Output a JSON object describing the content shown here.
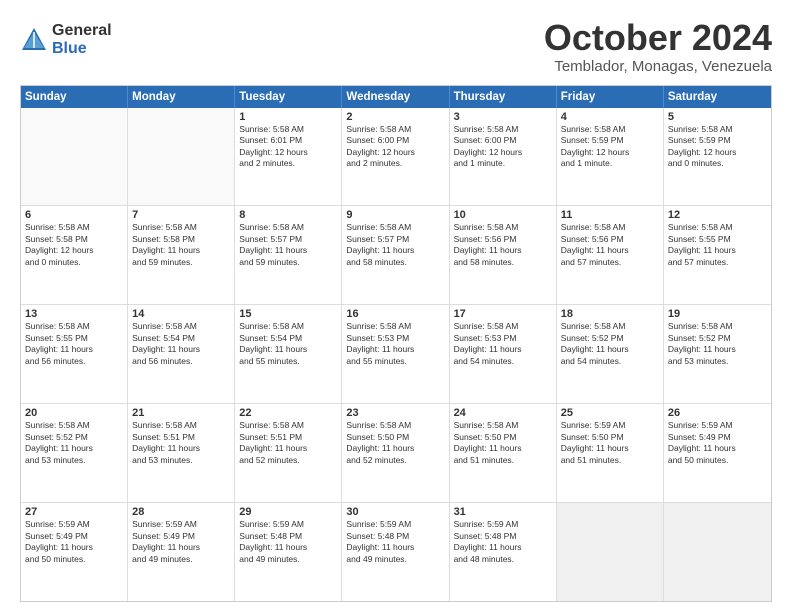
{
  "logo": {
    "general": "General",
    "blue": "Blue"
  },
  "header": {
    "title": "October 2024",
    "subtitle": "Temblador, Monagas, Venezuela"
  },
  "days": [
    "Sunday",
    "Monday",
    "Tuesday",
    "Wednesday",
    "Thursday",
    "Friday",
    "Saturday"
  ],
  "weeks": [
    [
      {
        "day": "",
        "lines": []
      },
      {
        "day": "",
        "lines": []
      },
      {
        "day": "1",
        "lines": [
          "Sunrise: 5:58 AM",
          "Sunset: 6:01 PM",
          "Daylight: 12 hours",
          "and 2 minutes."
        ]
      },
      {
        "day": "2",
        "lines": [
          "Sunrise: 5:58 AM",
          "Sunset: 6:00 PM",
          "Daylight: 12 hours",
          "and 2 minutes."
        ]
      },
      {
        "day": "3",
        "lines": [
          "Sunrise: 5:58 AM",
          "Sunset: 6:00 PM",
          "Daylight: 12 hours",
          "and 1 minute."
        ]
      },
      {
        "day": "4",
        "lines": [
          "Sunrise: 5:58 AM",
          "Sunset: 5:59 PM",
          "Daylight: 12 hours",
          "and 1 minute."
        ]
      },
      {
        "day": "5",
        "lines": [
          "Sunrise: 5:58 AM",
          "Sunset: 5:59 PM",
          "Daylight: 12 hours",
          "and 0 minutes."
        ]
      }
    ],
    [
      {
        "day": "6",
        "lines": [
          "Sunrise: 5:58 AM",
          "Sunset: 5:58 PM",
          "Daylight: 12 hours",
          "and 0 minutes."
        ]
      },
      {
        "day": "7",
        "lines": [
          "Sunrise: 5:58 AM",
          "Sunset: 5:58 PM",
          "Daylight: 11 hours",
          "and 59 minutes."
        ]
      },
      {
        "day": "8",
        "lines": [
          "Sunrise: 5:58 AM",
          "Sunset: 5:57 PM",
          "Daylight: 11 hours",
          "and 59 minutes."
        ]
      },
      {
        "day": "9",
        "lines": [
          "Sunrise: 5:58 AM",
          "Sunset: 5:57 PM",
          "Daylight: 11 hours",
          "and 58 minutes."
        ]
      },
      {
        "day": "10",
        "lines": [
          "Sunrise: 5:58 AM",
          "Sunset: 5:56 PM",
          "Daylight: 11 hours",
          "and 58 minutes."
        ]
      },
      {
        "day": "11",
        "lines": [
          "Sunrise: 5:58 AM",
          "Sunset: 5:56 PM",
          "Daylight: 11 hours",
          "and 57 minutes."
        ]
      },
      {
        "day": "12",
        "lines": [
          "Sunrise: 5:58 AM",
          "Sunset: 5:55 PM",
          "Daylight: 11 hours",
          "and 57 minutes."
        ]
      }
    ],
    [
      {
        "day": "13",
        "lines": [
          "Sunrise: 5:58 AM",
          "Sunset: 5:55 PM",
          "Daylight: 11 hours",
          "and 56 minutes."
        ]
      },
      {
        "day": "14",
        "lines": [
          "Sunrise: 5:58 AM",
          "Sunset: 5:54 PM",
          "Daylight: 11 hours",
          "and 56 minutes."
        ]
      },
      {
        "day": "15",
        "lines": [
          "Sunrise: 5:58 AM",
          "Sunset: 5:54 PM",
          "Daylight: 11 hours",
          "and 55 minutes."
        ]
      },
      {
        "day": "16",
        "lines": [
          "Sunrise: 5:58 AM",
          "Sunset: 5:53 PM",
          "Daylight: 11 hours",
          "and 55 minutes."
        ]
      },
      {
        "day": "17",
        "lines": [
          "Sunrise: 5:58 AM",
          "Sunset: 5:53 PM",
          "Daylight: 11 hours",
          "and 54 minutes."
        ]
      },
      {
        "day": "18",
        "lines": [
          "Sunrise: 5:58 AM",
          "Sunset: 5:52 PM",
          "Daylight: 11 hours",
          "and 54 minutes."
        ]
      },
      {
        "day": "19",
        "lines": [
          "Sunrise: 5:58 AM",
          "Sunset: 5:52 PM",
          "Daylight: 11 hours",
          "and 53 minutes."
        ]
      }
    ],
    [
      {
        "day": "20",
        "lines": [
          "Sunrise: 5:58 AM",
          "Sunset: 5:52 PM",
          "Daylight: 11 hours",
          "and 53 minutes."
        ]
      },
      {
        "day": "21",
        "lines": [
          "Sunrise: 5:58 AM",
          "Sunset: 5:51 PM",
          "Daylight: 11 hours",
          "and 53 minutes."
        ]
      },
      {
        "day": "22",
        "lines": [
          "Sunrise: 5:58 AM",
          "Sunset: 5:51 PM",
          "Daylight: 11 hours",
          "and 52 minutes."
        ]
      },
      {
        "day": "23",
        "lines": [
          "Sunrise: 5:58 AM",
          "Sunset: 5:50 PM",
          "Daylight: 11 hours",
          "and 52 minutes."
        ]
      },
      {
        "day": "24",
        "lines": [
          "Sunrise: 5:58 AM",
          "Sunset: 5:50 PM",
          "Daylight: 11 hours",
          "and 51 minutes."
        ]
      },
      {
        "day": "25",
        "lines": [
          "Sunrise: 5:59 AM",
          "Sunset: 5:50 PM",
          "Daylight: 11 hours",
          "and 51 minutes."
        ]
      },
      {
        "day": "26",
        "lines": [
          "Sunrise: 5:59 AM",
          "Sunset: 5:49 PM",
          "Daylight: 11 hours",
          "and 50 minutes."
        ]
      }
    ],
    [
      {
        "day": "27",
        "lines": [
          "Sunrise: 5:59 AM",
          "Sunset: 5:49 PM",
          "Daylight: 11 hours",
          "and 50 minutes."
        ]
      },
      {
        "day": "28",
        "lines": [
          "Sunrise: 5:59 AM",
          "Sunset: 5:49 PM",
          "Daylight: 11 hours",
          "and 49 minutes."
        ]
      },
      {
        "day": "29",
        "lines": [
          "Sunrise: 5:59 AM",
          "Sunset: 5:48 PM",
          "Daylight: 11 hours",
          "and 49 minutes."
        ]
      },
      {
        "day": "30",
        "lines": [
          "Sunrise: 5:59 AM",
          "Sunset: 5:48 PM",
          "Daylight: 11 hours",
          "and 49 minutes."
        ]
      },
      {
        "day": "31",
        "lines": [
          "Sunrise: 5:59 AM",
          "Sunset: 5:48 PM",
          "Daylight: 11 hours",
          "and 48 minutes."
        ]
      },
      {
        "day": "",
        "lines": []
      },
      {
        "day": "",
        "lines": []
      }
    ]
  ]
}
